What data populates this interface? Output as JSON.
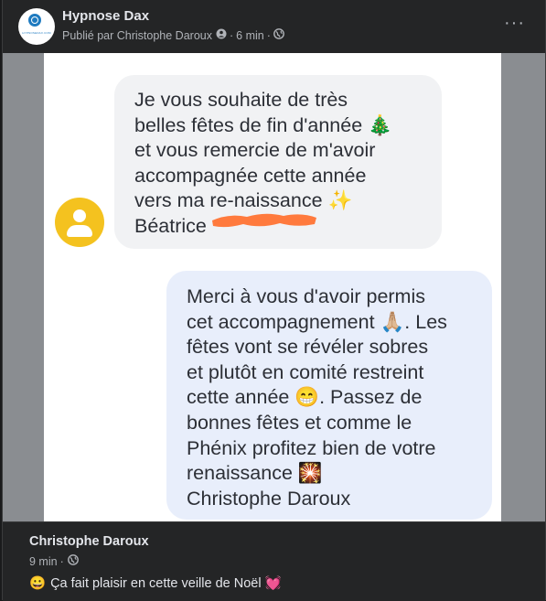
{
  "post": {
    "page_name": "Hypnose Dax",
    "published_by": "Publié par Christophe Daroux",
    "time": "6 min",
    "dot": "·",
    "more_menu": "···",
    "logo_text": "HYPNOSEDAX.COM"
  },
  "image": {
    "message_received": "Je vous souhaite de très\nbelles fêtes de fin d'année 🎄\net vous remercie de m'avoir\naccompagnée cette année\nvers ma re-naissance ✨\nBéatrice",
    "message_sent": "Merci à vous d'avoir permis\ncet accompagnement 🙏🏼. Les\nfêtes vont se révéler sobres\net plutôt en comité restreint\ncette année 😁. Passez de\nbonnes fêtes et comme le\nPhénix profitez bien de votre\nrenaissance 🎇\nChristophe Daroux",
    "redaction_color": "#ff7a3d",
    "avatar_color": "#f4c21f"
  },
  "comment": {
    "author": "Christophe Daroux",
    "time": "9 min",
    "dot": "·",
    "emoji_start": "😀",
    "text": "Ça fait plaisir en cette veille de Noël",
    "emoji_end": "💓"
  }
}
